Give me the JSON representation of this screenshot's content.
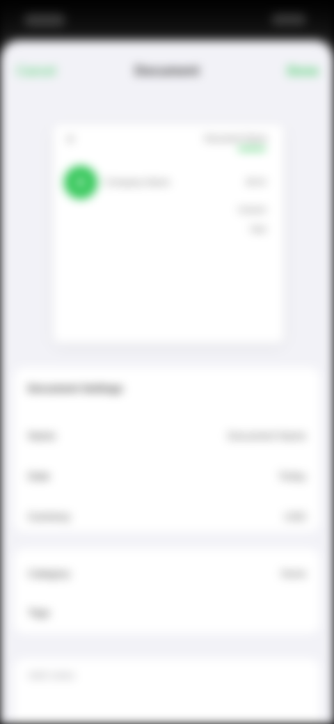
{
  "nav": {
    "cancel_label": "Cancel",
    "title": "Document",
    "done_label": "Done"
  },
  "preview": {
    "close_icon": "×",
    "header_text": "Document Name",
    "avatar_initial": "A",
    "name_text": "Company Name",
    "amount_text": "$0.00",
    "line1": "Subtotal",
    "line2": "Total"
  },
  "details": {
    "title": "Document Settings",
    "rows": [
      {
        "label": "Name",
        "value": "Document Name"
      },
      {
        "label": "Date",
        "value": "Today"
      },
      {
        "label": "Currency",
        "value": "USD"
      }
    ]
  },
  "extra": {
    "rows": [
      {
        "label": "Category",
        "value": "None"
      },
      {
        "label": "Tags",
        "value": ""
      }
    ]
  },
  "notes": {
    "placeholder": "Add notes"
  },
  "colors": {
    "accent": "#34c759",
    "background": "#f2f2f7",
    "danger": "#ff3b30"
  }
}
